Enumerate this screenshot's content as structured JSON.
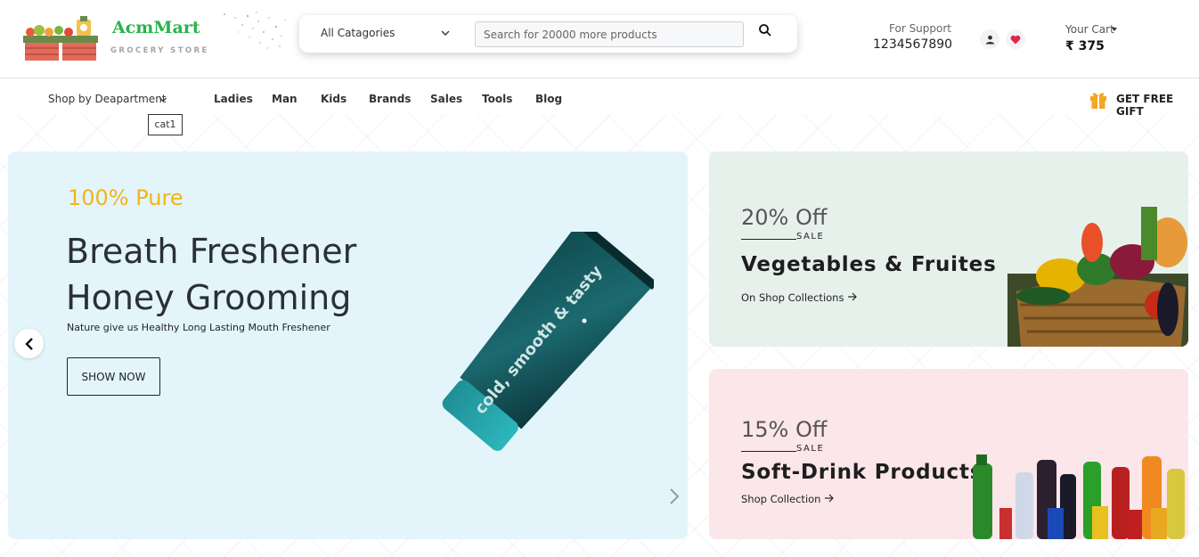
{
  "header": {
    "brand_name": "AcmMart",
    "brand_sub": "GROCERY STORE",
    "category_select": "All Catagories",
    "search_placeholder": "Search for 20000 more products",
    "support_label": "For Support",
    "support_phone": "1234567890",
    "cart_label": "Your Cart",
    "cart_amount": "₹ 375"
  },
  "nav": {
    "department_label": "Shop by Deapartment",
    "department_tag": "cat1",
    "links": [
      "Ladies",
      "Man",
      "Kids",
      "Brands",
      "Sales",
      "Tools",
      "Blog"
    ],
    "gift_label": "GET FREE GIFT"
  },
  "hero": {
    "tag": "100% Pure",
    "title_line1": "Breath Freshener",
    "title_line2": "Honey Grooming",
    "description": "Nature give us Healthy Long Lasting Mouth Freshener",
    "button_label": "SHOW NOW",
    "product_text": "cold, smooth & tasty"
  },
  "promos": [
    {
      "off": "20% Off",
      "sale": "SALE",
      "title": "Vegetables & Fruites",
      "link": "On Shop Collections"
    },
    {
      "off": "15% Off",
      "sale": "SALE",
      "title": "Soft-Drink Products",
      "link": "Shop Collection"
    }
  ],
  "colors": {
    "brand_green": "#2bb24c",
    "accent_yellow": "#f0b518",
    "hero_bg": "#e3f5fb",
    "promo1_bg": "#e7f1ec",
    "promo2_bg": "#fbe6ea",
    "gift_orange": "#f5a623"
  }
}
